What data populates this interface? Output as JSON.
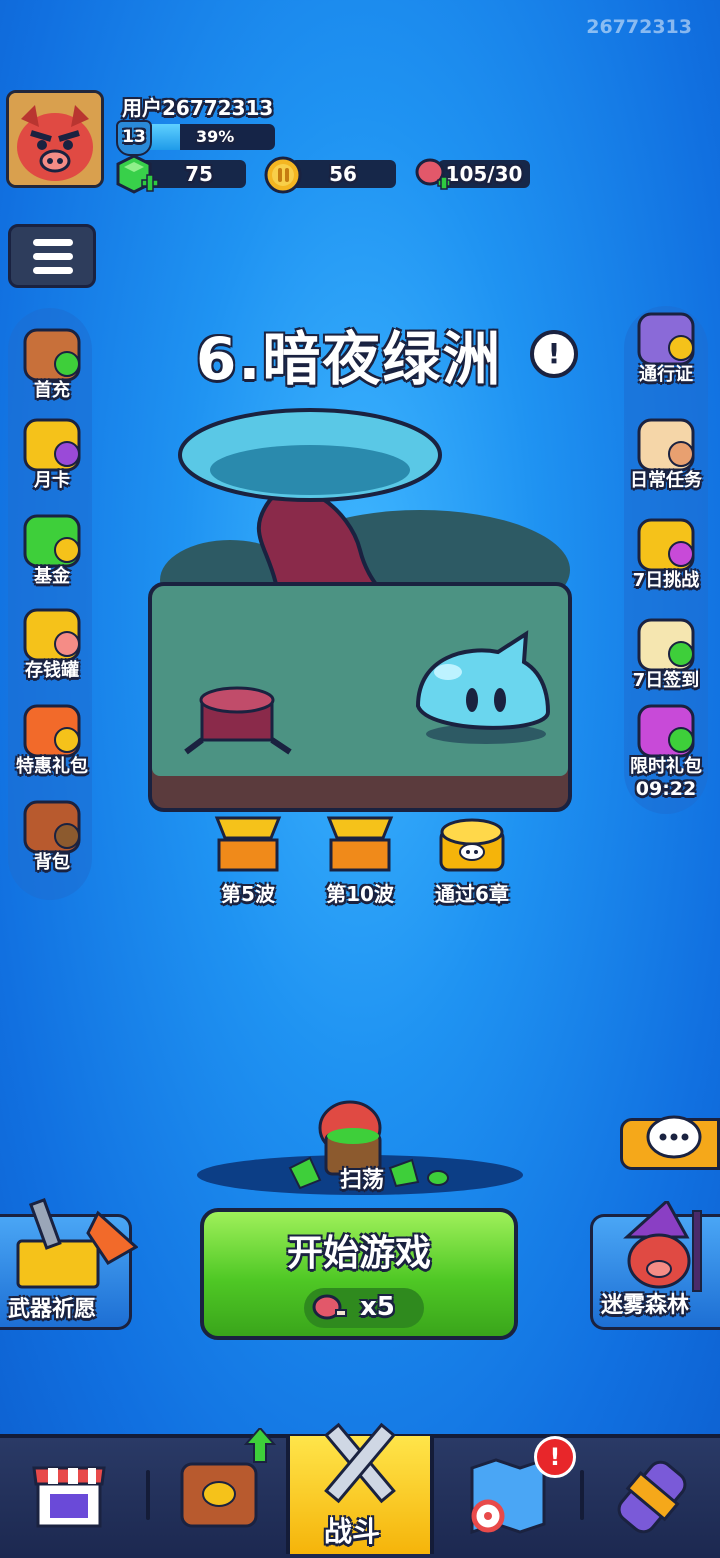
{
  "user": {
    "id": "26772313",
    "name": "用户26772313",
    "level": "13",
    "progress_pct": 39,
    "progress_label": "39%"
  },
  "resources": {
    "gems": "75",
    "coins": "56",
    "energy": "105/30"
  },
  "left_menu": [
    {
      "label": "首充",
      "icon": "first-charge-icon"
    },
    {
      "label": "月卡",
      "icon": "monthly-card-icon"
    },
    {
      "label": "基金",
      "icon": "fund-icon"
    },
    {
      "label": "存钱罐",
      "icon": "piggy-bank-icon"
    },
    {
      "label": "特惠礼包",
      "icon": "gift-box-icon"
    },
    {
      "label": "背包",
      "icon": "backpack-icon"
    }
  ],
  "right_menu": [
    {
      "label": "通行证",
      "icon": "battle-pass-icon"
    },
    {
      "label": "日常任务",
      "icon": "daily-task-icon"
    },
    {
      "label": "7日挑战",
      "icon": "seven-day-challenge-icon"
    },
    {
      "label": "7日签到",
      "icon": "seven-day-signin-icon"
    },
    {
      "label": "限时礼包",
      "icon": "limited-gift-icon",
      "timer": "09:22"
    }
  ],
  "chapter": {
    "title": "6.暗夜绿洲"
  },
  "rewards": [
    {
      "label": "第5波"
    },
    {
      "label": "第10波"
    },
    {
      "label": "通过6章"
    }
  ],
  "sweep": {
    "label": "扫荡"
  },
  "start": {
    "label": "开始游戏",
    "cost": "x5"
  },
  "side_buttons": {
    "weapon": "武器祈愿",
    "forest": "迷雾森林"
  },
  "bottom_nav": {
    "battle": "战斗",
    "active": "battle",
    "badge": "!"
  },
  "colors": {
    "bg": "#1f93f2",
    "start_green": "#4fc825",
    "nav_active": "#f5c21a",
    "outline": "#1a2240"
  }
}
